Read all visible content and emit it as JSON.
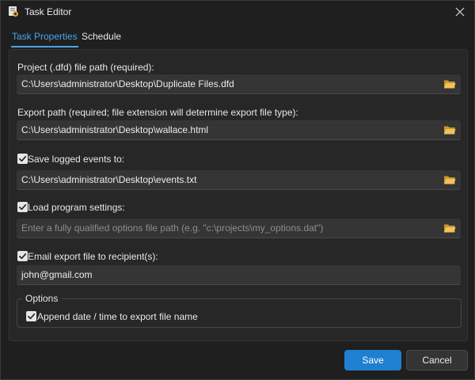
{
  "window": {
    "title": "Task Editor"
  },
  "tabs": [
    {
      "label": "Task Properties",
      "active": true
    },
    {
      "label": "Schedule",
      "active": false
    }
  ],
  "project": {
    "label": "Project (.dfd) file path (required):",
    "value": "C:\\Users\\administrator\\Desktop\\Duplicate Files.dfd"
  },
  "export": {
    "label": "Export path (required; file extension will determine export file type):",
    "value": "C:\\Users\\administrator\\Desktop\\wallace.html"
  },
  "log": {
    "label": "Save logged events to:",
    "checked": true,
    "value": "C:\\Users\\administrator\\Desktop\\events.txt"
  },
  "settings": {
    "label": "Load program settings:",
    "checked": true,
    "value": "",
    "placeholder": "Enter a fully qualified options file path (e.g. \"c:\\projects\\my_options.dat\")"
  },
  "email": {
    "label": "Email export file to recipient(s):",
    "checked": true,
    "value": "john@gmail.com"
  },
  "options": {
    "legend": "Options",
    "append_label": "Append date / time to export file name",
    "append_checked": true
  },
  "buttons": {
    "save": "Save",
    "cancel": "Cancel"
  },
  "colors": {
    "accent": "#1f7fd1",
    "tab_active": "#4aa3e8",
    "folder": "#e6b653"
  },
  "icons": {
    "app": "app-icon",
    "close": "close-icon",
    "browse": "folder-icon",
    "check": "checkmark-icon"
  }
}
